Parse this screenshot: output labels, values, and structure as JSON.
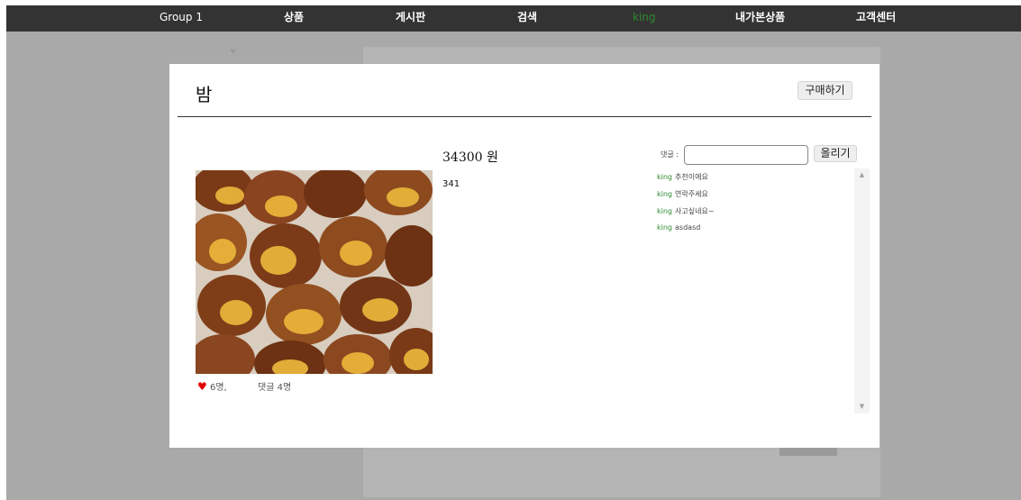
{
  "nav": {
    "brand": "Group 1",
    "items": [
      {
        "label": "상품"
      },
      {
        "label": "게시판"
      },
      {
        "label": "검색"
      },
      {
        "label": "king"
      },
      {
        "label": "내가본상품"
      },
      {
        "label": "고객센터"
      }
    ],
    "active_color": "#2f8a2f"
  },
  "modal": {
    "title": "밤",
    "buy_label": "구매하기",
    "price": "34300 원",
    "description": "341",
    "likes": "6명,",
    "comments_count": "댓글 4명",
    "heart_icon": "heart-icon",
    "comment_label": "댓글 :",
    "comment_placeholder": "",
    "post_label": "올리기",
    "comments": [
      {
        "author": "king",
        "text": "추천이에요"
      },
      {
        "author": "king",
        "text": "연락주세요"
      },
      {
        "author": "king",
        "text": "사고싶네요~"
      },
      {
        "author": "king",
        "text": "asdasd"
      }
    ]
  },
  "colors": {
    "navbar": "#333333",
    "overlay": "#a9a9a9",
    "heart": "#e00000",
    "author": "#2f8a2f"
  }
}
